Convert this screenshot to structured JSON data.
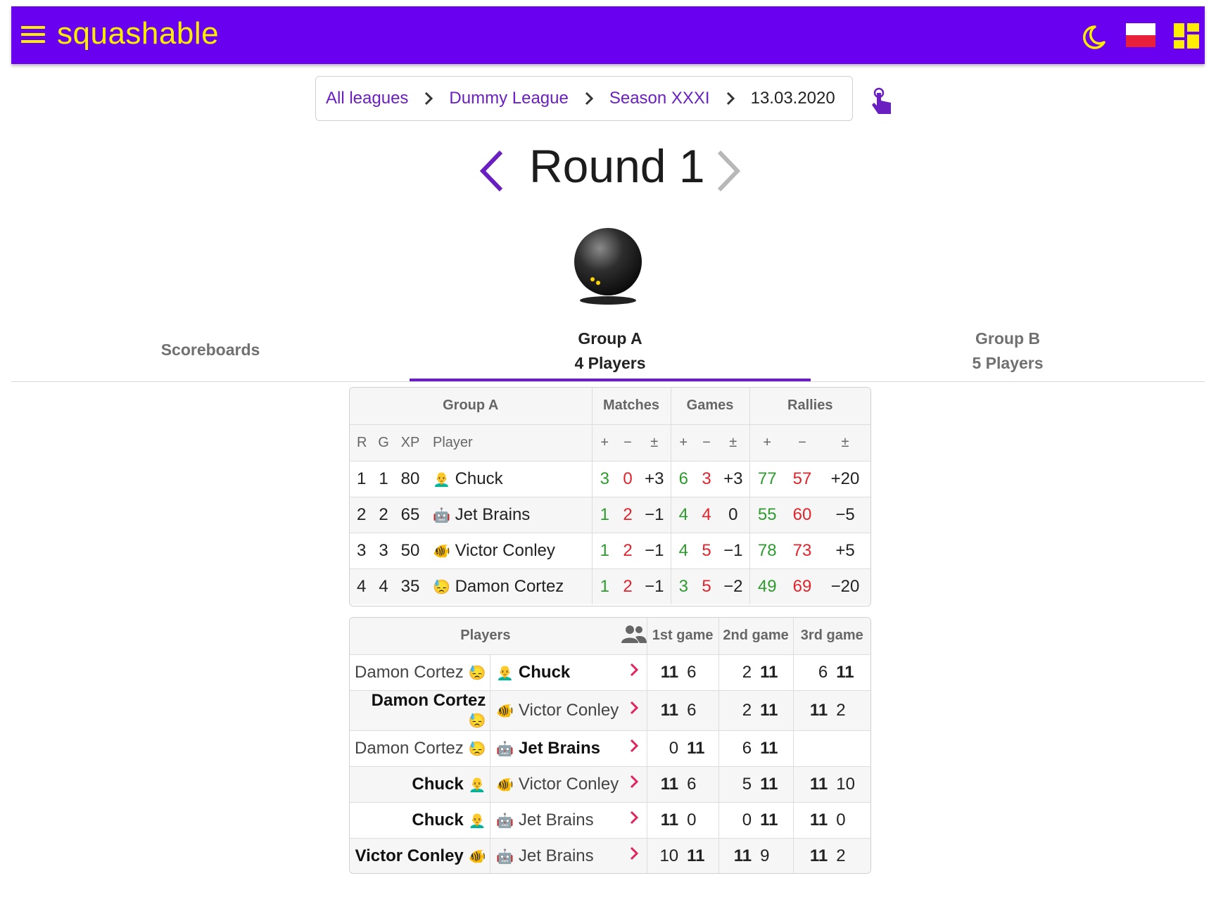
{
  "app": {
    "brand": "squashable"
  },
  "breadcrumb": {
    "items": [
      "All leagues",
      "Dummy League",
      "Season XXXI"
    ],
    "current": "13.03.2020"
  },
  "round": {
    "title": "Round 1"
  },
  "tabs": [
    {
      "label": "Scoreboards",
      "sub": ""
    },
    {
      "label": "Group A",
      "sub": "4 Players"
    },
    {
      "label": "Group B",
      "sub": "5 Players"
    }
  ],
  "standings": {
    "group_title": "Group A",
    "matches_h": "Matches",
    "games_h": "Games",
    "rallies_h": "Rallies",
    "col": {
      "r": "R",
      "g": "G",
      "xp": "XP",
      "player": "Player",
      "plus": "+",
      "minus": "−",
      "pm": "±"
    },
    "rows": [
      {
        "r": "1",
        "g": "1",
        "xp": "80",
        "emoji": "👨‍🦲",
        "player": "Chuck",
        "mp": "3",
        "mm": "0",
        "md": "+3",
        "gp": "6",
        "gm": "3",
        "gd": "+3",
        "rp": "77",
        "rm": "57",
        "rd": "+20"
      },
      {
        "r": "2",
        "g": "2",
        "xp": "65",
        "emoji": "🤖",
        "player": "Jet Brains",
        "mp": "1",
        "mm": "2",
        "md": "−1",
        "gp": "4",
        "gm": "4",
        "gd": "0",
        "rp": "55",
        "rm": "60",
        "rd": "−5"
      },
      {
        "r": "3",
        "g": "3",
        "xp": "50",
        "emoji": "🐠",
        "player": "Victor Conley",
        "mp": "1",
        "mm": "2",
        "md": "−1",
        "gp": "4",
        "gm": "5",
        "gd": "−1",
        "rp": "78",
        "rm": "73",
        "rd": "+5"
      },
      {
        "r": "4",
        "g": "4",
        "xp": "35",
        "emoji": "😓",
        "player": "Damon Cortez",
        "mp": "1",
        "mm": "2",
        "md": "−1",
        "gp": "3",
        "gm": "5",
        "gd": "−2",
        "rp": "49",
        "rm": "69",
        "rd": "−20"
      }
    ]
  },
  "results": {
    "players_h": "Players",
    "game1_h": "1st game",
    "game2_h": "2nd game",
    "game3_h": "3rd game",
    "matches": [
      {
        "p1": "Damon Cortez",
        "e1": "😓",
        "p2": "Chuck",
        "e2": "👨‍🦲",
        "win": 2,
        "g": [
          [
            "11",
            "6",
            1
          ],
          [
            "2",
            "11",
            2
          ],
          [
            "6",
            "11",
            2
          ]
        ]
      },
      {
        "p1": "Damon Cortez",
        "e1": "😓",
        "p2": "Victor Conley",
        "e2": "🐠",
        "win": 1,
        "g": [
          [
            "11",
            "6",
            1
          ],
          [
            "2",
            "11",
            2
          ],
          [
            "11",
            "2",
            1
          ]
        ]
      },
      {
        "p1": "Damon Cortez",
        "e1": "😓",
        "p2": "Jet Brains",
        "e2": "🤖",
        "win": 2,
        "g": [
          [
            "0",
            "11",
            2
          ],
          [
            "6",
            "11",
            2
          ],
          [
            "",
            "",
            0
          ]
        ]
      },
      {
        "p1": "Chuck",
        "e1": "👨‍🦲",
        "p2": "Victor Conley",
        "e2": "🐠",
        "win": 1,
        "g": [
          [
            "11",
            "6",
            1
          ],
          [
            "5",
            "11",
            2
          ],
          [
            "11",
            "10",
            1
          ]
        ]
      },
      {
        "p1": "Chuck",
        "e1": "👨‍🦲",
        "p2": "Jet Brains",
        "e2": "🤖",
        "win": 1,
        "g": [
          [
            "11",
            "0",
            1
          ],
          [
            "0",
            "11",
            2
          ],
          [
            "11",
            "0",
            1
          ]
        ]
      },
      {
        "p1": "Victor Conley",
        "e1": "🐠",
        "p2": "Jet Brains",
        "e2": "🤖",
        "win": 1,
        "g": [
          [
            "10",
            "11",
            2
          ],
          [
            "11",
            "9",
            1
          ],
          [
            "11",
            "2",
            1
          ]
        ]
      }
    ]
  },
  "colors": {
    "appbar": "#6a00f0",
    "accent": "#ffee00",
    "link": "#6a1fc0",
    "win": "#2e9b2e",
    "loss": "#e0242c",
    "chevron": "#e0245e"
  },
  "icons": {
    "menu": "menu-icon",
    "moon": "moon-icon",
    "flag": "poland-flag-icon",
    "grid": "dashboard-icon",
    "touch": "touch-icon",
    "ball": "squash-ball-icon",
    "group": "group-icon"
  }
}
